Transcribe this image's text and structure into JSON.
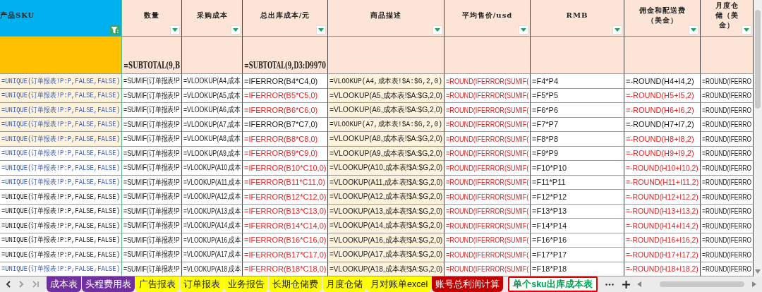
{
  "columns": [
    {
      "header": "产品SKU",
      "kind": "key",
      "shaded": false,
      "filter_active": true
    },
    {
      "header": "数量",
      "kind": "field",
      "shaded": false,
      "filter_active": false,
      "subtotal": "=SUBTOTAL(9,B"
    },
    {
      "header": "采购成本",
      "kind": "field",
      "shaded": false,
      "filter_active": false
    },
    {
      "header": "总出库成本/元",
      "kind": "field",
      "shaded": false,
      "filter_active": false,
      "subtotal": "=SUBTOTAL(9,D3:D9970"
    },
    {
      "header": "商品描述",
      "kind": "field",
      "shaded": true,
      "filter_active": false
    },
    {
      "header": "平均售价/usd",
      "kind": "field",
      "shaded": false,
      "filter_active": false
    },
    {
      "header": "RMB",
      "kind": "field",
      "shaded": false,
      "filter_active": false
    },
    {
      "header": "佣金和配送费（美金）",
      "kind": "field",
      "shaded": false,
      "filter_active": false
    },
    {
      "header": "月度仓储（美金）",
      "kind": "field",
      "shaded": false,
      "filter_active": false
    }
  ],
  "rows": [
    {
      "highlighted": true,
      "cells": [
        {
          "text": "=UNIQUE(订单报表!P:P,FALSE,FALSE)",
          "kind": "link"
        },
        {
          "text": "=SUMIF(订单报表!P",
          "kind": "plain"
        },
        {
          "text": "=VLOOKUP(A4,成本",
          "kind": "plain"
        },
        {
          "text": "=IFERROR(B4*C4,0)",
          "kind": "plain"
        },
        {
          "text": "=VLOOKUP(A4,成本表!$A:$G,2,0)",
          "kind": "mono"
        },
        {
          "text": "=ROUND(IFERROR(SUMIF(",
          "kind": "red"
        },
        {
          "text": "=F4*P4",
          "kind": "plain"
        },
        {
          "text": "=-ROUND(H4+I4,2)",
          "kind": "plain"
        },
        {
          "text": "=ROUND(IFERRO",
          "kind": "plain"
        }
      ]
    },
    {
      "highlighted": true,
      "cells": [
        {
          "text": "=UNIQUE(订单报表!P:P,FALSE,FALSE)",
          "kind": "link"
        },
        {
          "text": "=SUMIF(订单报表!P",
          "kind": "plain"
        },
        {
          "text": "=VLOOKUP(A5,成本",
          "kind": "plain"
        },
        {
          "text": "=IFERROR(B5*C5,0)",
          "kind": "red"
        },
        {
          "text": "=VLOOKUP(A5,成本表!$A:$G,2,0)",
          "kind": "plain"
        },
        {
          "text": "=ROUND(IFERROR(SUMIF(",
          "kind": "red"
        },
        {
          "text": "=F5*P5",
          "kind": "plain"
        },
        {
          "text": "=-ROUND(H5+I5,2)",
          "kind": "red"
        },
        {
          "text": "=ROUND(IFERRO",
          "kind": "plain"
        }
      ]
    },
    {
      "highlighted": true,
      "cells": [
        {
          "text": "=UNIQUE(订单报表!P:P,FALSE,FALSE)",
          "kind": "link"
        },
        {
          "text": "=SUMIF(订单报表!P",
          "kind": "plain"
        },
        {
          "text": "=VLOOKUP(A6,成本",
          "kind": "plain"
        },
        {
          "text": "=IFERROR(B6*C6,0)",
          "kind": "red"
        },
        {
          "text": "=VLOOKUP(A6,成本表!$A:$G,2,0)",
          "kind": "plain"
        },
        {
          "text": "=ROUND(IFERROR(SUMIF(",
          "kind": "red"
        },
        {
          "text": "=F6*P6",
          "kind": "plain"
        },
        {
          "text": "=-ROUND(H6+I6,2)",
          "kind": "red"
        },
        {
          "text": "=ROUND(IFERRO",
          "kind": "plain"
        }
      ]
    },
    {
      "highlighted": true,
      "cells": [
        {
          "text": "=UNIQUE(订单报表!P:P,FALSE,FALSE)",
          "kind": "link"
        },
        {
          "text": "=SUMIF(订单报表!P",
          "kind": "plain"
        },
        {
          "text": "=VLOOKUP(A7,成本",
          "kind": "plain"
        },
        {
          "text": "=IFERROR(B7*C7,0)",
          "kind": "plain"
        },
        {
          "text": "=VLOOKUP(A7,成本表!$A:$G,2,0)",
          "kind": "mono"
        },
        {
          "text": "=ROUND(IFERROR(SUMIF(",
          "kind": "red"
        },
        {
          "text": "=F7*P7",
          "kind": "plain"
        },
        {
          "text": "=-ROUND(H7+I7,2)",
          "kind": "plain"
        },
        {
          "text": "=ROUND(IFERRO",
          "kind": "plain"
        }
      ]
    },
    {
      "highlighted": true,
      "cells": [
        {
          "text": "=UNIQUE(订单报表!P:P,FALSE,FALSE)",
          "kind": "link"
        },
        {
          "text": "=SUMIF(订单报表!P",
          "kind": "plain"
        },
        {
          "text": "=VLOOKUP(A8,成本",
          "kind": "plain"
        },
        {
          "text": "=IFERROR(B8*C8,0)",
          "kind": "red"
        },
        {
          "text": "=VLOOKUP(A8,成本表!$A:$G,2,0)",
          "kind": "plain"
        },
        {
          "text": "=ROUND(IFERROR(SUMIF(",
          "kind": "red"
        },
        {
          "text": "=F8*P8",
          "kind": "plain"
        },
        {
          "text": "=-ROUND(H8+I8,2)",
          "kind": "red"
        },
        {
          "text": "=ROUND(IFERRO",
          "kind": "plain"
        }
      ]
    },
    {
      "highlighted": false,
      "cells": [
        {
          "text": "=UNIQUE(订单报表!P:P,FALSE,FALSE)",
          "kind": "link"
        },
        {
          "text": "=SUMIF(订单报表!P",
          "kind": "plain"
        },
        {
          "text": "=VLOOKUP(A9,成本",
          "kind": "plain"
        },
        {
          "text": "=IFERROR(B9*C9,0)",
          "kind": "red"
        },
        {
          "text": "=VLOOKUP(A9,成本表!$A:$G,2,0)",
          "kind": "plain"
        },
        {
          "text": "=ROUND(IFERROR(SUMIF(",
          "kind": "red"
        },
        {
          "text": "=F9*P9",
          "kind": "plain"
        },
        {
          "text": "=-ROUND(H9+I9,2)",
          "kind": "red"
        },
        {
          "text": "=ROUND(IFERRO",
          "kind": "plain"
        }
      ]
    },
    {
      "highlighted": false,
      "cells": [
        {
          "text": "=UNIQUE(订单报表!P:P,FALSE,FALSE)",
          "kind": "link"
        },
        {
          "text": "=SUMIF(订单报表!P",
          "kind": "plain"
        },
        {
          "text": "=VLOOKUP(A10,成本",
          "kind": "plain"
        },
        {
          "text": "=IFERROR(B10*C10,0)",
          "kind": "red"
        },
        {
          "text": "=VLOOKUP(A10,成本表!$A:$G,2,0)",
          "kind": "plain"
        },
        {
          "text": "=ROUND(IFERROR(SUMIF(",
          "kind": "red"
        },
        {
          "text": "=F10*P10",
          "kind": "plain"
        },
        {
          "text": "=-ROUND(H10+I10,2)",
          "kind": "red"
        },
        {
          "text": "=ROUND(IFERRO",
          "kind": "plain"
        }
      ]
    },
    {
      "highlighted": false,
      "cells": [
        {
          "text": "=UNIQUE(订单报表!P:P,FALSE,FALSE)",
          "kind": "link"
        },
        {
          "text": "=SUMIF(订单报表!P",
          "kind": "plain"
        },
        {
          "text": "=VLOOKUP(A11,成本",
          "kind": "plain"
        },
        {
          "text": "=IFERROR(B11*C11,0)",
          "kind": "red"
        },
        {
          "text": "=VLOOKUP(A11,成本表!$A:$G,2,0)",
          "kind": "plain"
        },
        {
          "text": "=ROUND(IFERROR(SUMIF(",
          "kind": "red"
        },
        {
          "text": "=F11*P11",
          "kind": "plain"
        },
        {
          "text": "=-ROUND(H11+I11,2)",
          "kind": "red"
        },
        {
          "text": "=ROUND(IFERRO",
          "kind": "plain"
        }
      ]
    },
    {
      "highlighted": false,
      "cells": [
        {
          "text": "=UNIQUE(订单报表!P:P,FALSE,FALSE)",
          "kind": "mono"
        },
        {
          "text": "=SUMIF(订单报表!P",
          "kind": "plain"
        },
        {
          "text": "=VLOOKUP(A12,成本",
          "kind": "plain"
        },
        {
          "text": "=IFERROR(B12*C12,0)",
          "kind": "red"
        },
        {
          "text": "=VLOOKUP(A12,成本表!$A:$G,2,0)",
          "kind": "plain"
        },
        {
          "text": "=ROUND(IFERROR(SUMIF(",
          "kind": "red"
        },
        {
          "text": "=F12*P12",
          "kind": "plain"
        },
        {
          "text": "=-ROUND(H12+I12,2)",
          "kind": "red"
        },
        {
          "text": "=ROUND(IFERRO",
          "kind": "plain"
        }
      ]
    },
    {
      "highlighted": false,
      "cells": [
        {
          "text": "=UNIQUE(订单报表!P:P,FALSE,FALSE)",
          "kind": "mono"
        },
        {
          "text": "=SUMIF(订单报表!P",
          "kind": "plain"
        },
        {
          "text": "=VLOOKUP(A13,成本",
          "kind": "plain"
        },
        {
          "text": "=IFERROR(B13*C13,0)",
          "kind": "red"
        },
        {
          "text": "=VLOOKUP(A13,成本表!$A:$G,2,0)",
          "kind": "plain"
        },
        {
          "text": "=ROUND(IFERROR(SUMIF(",
          "kind": "red"
        },
        {
          "text": "=F13*P13",
          "kind": "plain"
        },
        {
          "text": "=-ROUND(H13+I13,2)",
          "kind": "red"
        },
        {
          "text": "=ROUND(IFERRO",
          "kind": "plain"
        }
      ]
    },
    {
      "highlighted": false,
      "cells": [
        {
          "text": "=UNIQUE(订单报表!P:P,FALSE,FALSE)",
          "kind": "mono"
        },
        {
          "text": "=SUMIF(订单报表!P",
          "kind": "plain"
        },
        {
          "text": "=VLOOKUP(A14,成本",
          "kind": "plain"
        },
        {
          "text": "=IFERROR(B14*C14,0)",
          "kind": "red"
        },
        {
          "text": "=VLOOKUP(A14,成本表!$A:$G,2,0)",
          "kind": "plain"
        },
        {
          "text": "=ROUND(IFERROR(SUMIF(",
          "kind": "red"
        },
        {
          "text": "=F14*P14",
          "kind": "plain"
        },
        {
          "text": "=-ROUND(H14+I14,2)",
          "kind": "red"
        },
        {
          "text": "=ROUND(IFERRO",
          "kind": "plain"
        }
      ]
    },
    {
      "highlighted": false,
      "cells": [
        {
          "text": "=UNIQUE(订单报表!P:P,FALSE,FALSE)",
          "kind": "mono"
        },
        {
          "text": "=SUMIF(订单报表!P",
          "kind": "plain"
        },
        {
          "text": "=VLOOKUP(A16,成本",
          "kind": "plain"
        },
        {
          "text": "=IFERROR(B16*C16,0)",
          "kind": "red"
        },
        {
          "text": "=VLOOKUP(A16,成本表!$A:$G,2,0)",
          "kind": "plain"
        },
        {
          "text": "=ROUND(IFERROR(SUMIF(",
          "kind": "red"
        },
        {
          "text": "=F16*P16",
          "kind": "plain"
        },
        {
          "text": "=-ROUND(H16+I16,2)",
          "kind": "red"
        },
        {
          "text": "=ROUND(IFERRO",
          "kind": "plain"
        }
      ]
    },
    {
      "highlighted": false,
      "cells": [
        {
          "text": "=UNIQUE(订单报表!P:P,FALSE,FALSE)",
          "kind": "mono"
        },
        {
          "text": "=SUMIF(订单报表!P",
          "kind": "plain"
        },
        {
          "text": "=VLOOKUP(A17,成本",
          "kind": "plain"
        },
        {
          "text": "=IFERROR(B17*C17,0)",
          "kind": "red"
        },
        {
          "text": "=VLOOKUP(A17,成本表!$A:$G,2,0)",
          "kind": "plain"
        },
        {
          "text": "=ROUND(IFERROR(SUMIF(",
          "kind": "red"
        },
        {
          "text": "=F17*P17",
          "kind": "plain"
        },
        {
          "text": "=-ROUND(H17+I17,2)",
          "kind": "red"
        },
        {
          "text": "=ROUND(IFERRO",
          "kind": "plain"
        }
      ]
    },
    {
      "highlighted": false,
      "cells": [
        {
          "text": "=UNIQUE(订单报表!P:P,FALSE,FALSE)",
          "kind": "link"
        },
        {
          "text": "=SUMIF(订单报表!P",
          "kind": "plain"
        },
        {
          "text": "=VLOOKUP(A18,成本",
          "kind": "plain"
        },
        {
          "text": "=IFERROR(B18*C18,0)",
          "kind": "red"
        },
        {
          "text": "=VLOOKUP(A18,成本表!$A:$G,2,0)",
          "kind": "plain"
        },
        {
          "text": "=ROUND(IFERROR(SUMIF(",
          "kind": "red"
        },
        {
          "text": "=F18*P18",
          "kind": "plain"
        },
        {
          "text": "=-ROUND(H18+I18,2)",
          "kind": "red"
        },
        {
          "text": "=ROUND(IFERRO",
          "kind": "plain"
        }
      ]
    }
  ],
  "sheet_tabs": [
    {
      "label": "成本表",
      "color": "#7030a0",
      "selected": false
    },
    {
      "label": "头程费用表",
      "color": "#7030a0",
      "selected": false
    },
    {
      "label": "广告报表",
      "color": "#ffff00",
      "selected": false
    },
    {
      "label": "订单报表",
      "color": "#ffff00",
      "selected": false
    },
    {
      "label": "业务报告",
      "color": "#ffff00",
      "selected": false
    },
    {
      "label": "长期仓储费",
      "color": "#ffff00",
      "selected": false
    },
    {
      "label": "月度仓储",
      "color": "#ffff00",
      "selected": false
    },
    {
      "label": "月对账单excel",
      "color": "#ffff00",
      "selected": false
    },
    {
      "label": "账号总利润计算",
      "color": "#c00000",
      "selected": false
    },
    {
      "label": "单个sku出库成本表",
      "color": "#00a050",
      "selected": true
    }
  ]
}
